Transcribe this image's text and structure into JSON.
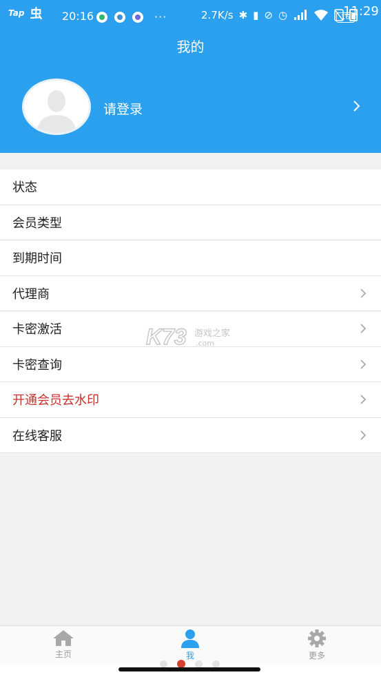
{
  "status_bar": {
    "carrier_tap": "Tap",
    "carrier_icon": "虫",
    "time_left": "20:16",
    "more": "···",
    "net_speed": "2.7K/s",
    "battery_level": "16",
    "clock": "11:29"
  },
  "header": {
    "title": "我的"
  },
  "profile": {
    "login_text": "请登录"
  },
  "menu": [
    {
      "label": "状态",
      "chevron": false
    },
    {
      "label": "会员类型",
      "chevron": false
    },
    {
      "label": "到期时间",
      "chevron": false
    },
    {
      "label": "代理商",
      "chevron": true
    },
    {
      "label": "卡密激活",
      "chevron": true
    },
    {
      "label": "卡密查询",
      "chevron": true
    },
    {
      "label": "开通会员去水印",
      "chevron": true,
      "color": "#c9302c"
    },
    {
      "label": "在线客服",
      "chevron": true
    }
  ],
  "watermark": {
    "logo": "K73",
    "text": "游戏之家",
    "domain": ".com"
  },
  "bottom_nav": {
    "home": "主页",
    "me": "我",
    "more": "更多"
  },
  "colors": {
    "accent": "#2ba0ee",
    "highlight": "#c9302c"
  }
}
